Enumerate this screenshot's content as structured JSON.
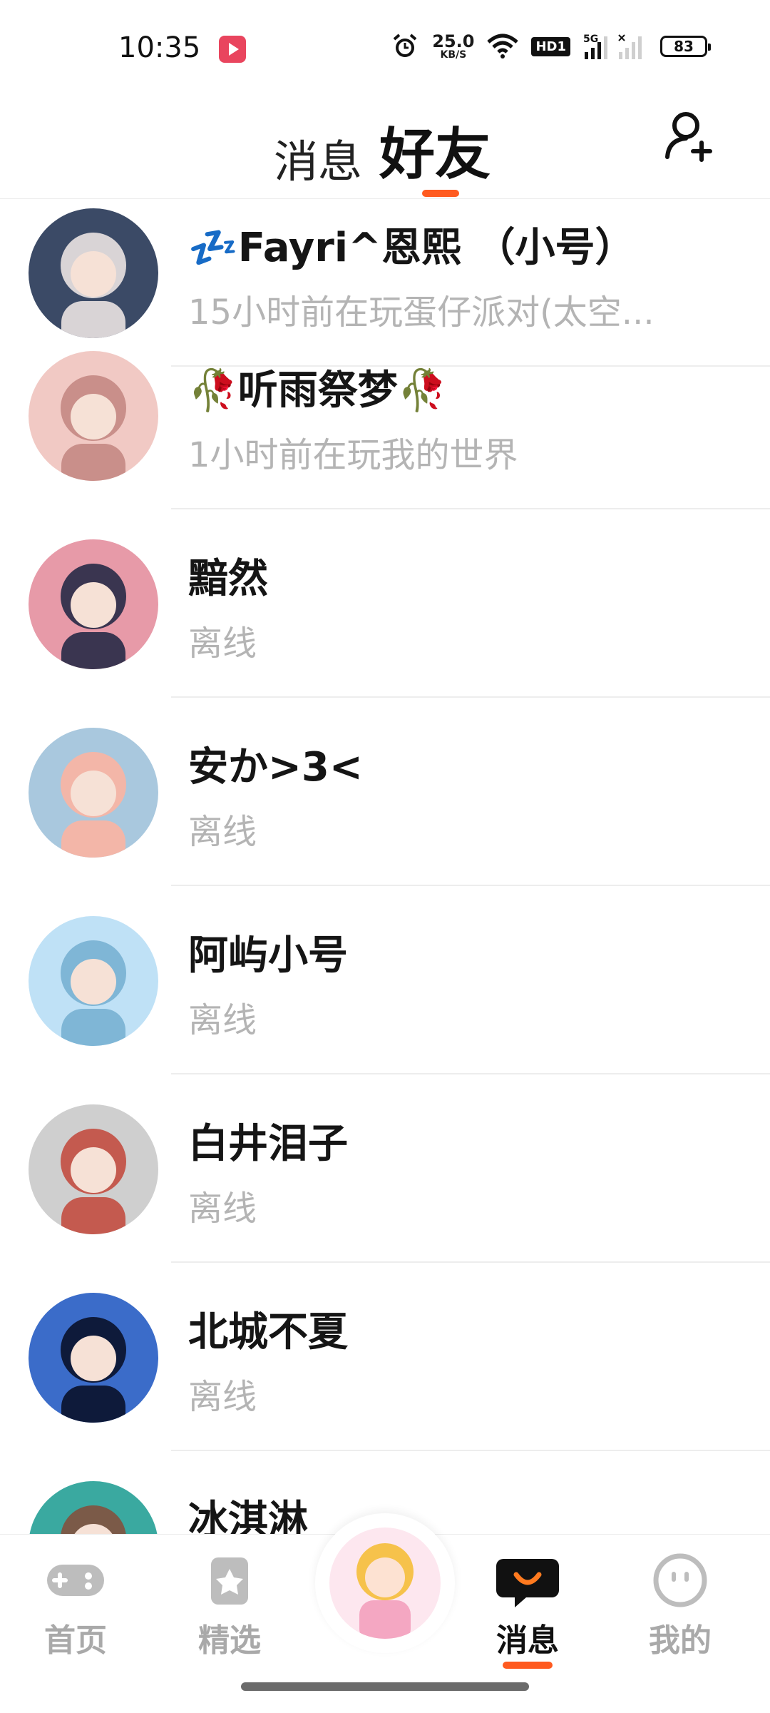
{
  "status_bar": {
    "time": "10:35",
    "net_speed_value": "25.0",
    "net_speed_unit": "KB/S",
    "hd_label": "HD1",
    "network_type": "5G",
    "battery": "83",
    "icons": [
      "media-app-icon",
      "alarm-icon",
      "wifi-icon",
      "signal-icon"
    ]
  },
  "header": {
    "tab_messages": "消息",
    "tab_friends": "好友",
    "active_tab": "好友",
    "add_friend_icon": "add-user-icon",
    "accent_color": "#ff5a1f"
  },
  "friends": [
    {
      "name": "💤Fayri^恩熙  （小号）",
      "status": "15小时前在玩蛋仔派对(太空...",
      "avatar_colors": [
        "#3b4a66",
        "#d9d4d6"
      ]
    },
    {
      "name": "🥀听雨祭梦🥀",
      "status": "1小时前在玩我的世界",
      "avatar_colors": [
        "#f1c9c4",
        "#c98f8a"
      ]
    },
    {
      "name": "黯然",
      "status": "离线",
      "avatar_colors": [
        "#e79aa8",
        "#3a3550"
      ]
    },
    {
      "name": "安か>3<",
      "status": "离线",
      "avatar_colors": [
        "#a9c8de",
        "#f3b6a8"
      ]
    },
    {
      "name": "阿屿小号",
      "status": "离线",
      "avatar_colors": [
        "#bfe1f6",
        "#7fb6d6"
      ]
    },
    {
      "name": "白井泪子",
      "status": "离线",
      "avatar_colors": [
        "#cfcfcf",
        "#c45a4f"
      ]
    },
    {
      "name": "北城不夏",
      "status": "离线",
      "avatar_colors": [
        "#3b6cc9",
        "#0e1a3a"
      ]
    },
    {
      "name": "冰淇淋",
      "status": "",
      "avatar_colors": [
        "#3aa9a0",
        "#7b5a48"
      ]
    }
  ],
  "bottom_nav": {
    "items": [
      {
        "label": "首页",
        "icon": "gamepad-icon"
      },
      {
        "label": "精选",
        "icon": "star-icon"
      },
      {
        "label": "消息",
        "icon": "chat-icon",
        "active": true
      },
      {
        "label": "我的",
        "icon": "face-icon"
      }
    ],
    "center_avatar_colors": [
      "#f6c24b",
      "#f4a7c2"
    ]
  }
}
